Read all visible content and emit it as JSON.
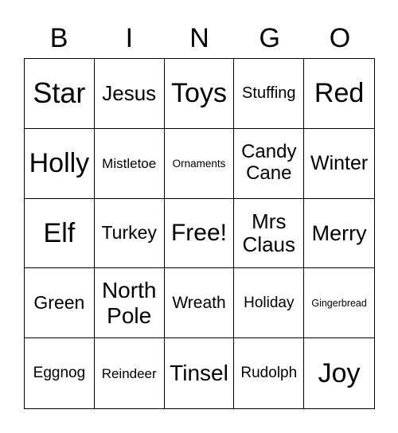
{
  "header": [
    "B",
    "I",
    "N",
    "G",
    "O"
  ],
  "cells": [
    "Star",
    "Jesus",
    "Toys",
    "Stuffing",
    "Red",
    "Holly",
    "Mistletoe",
    "Ornaments",
    "Candy Cane",
    "Winter",
    "Elf",
    "Turkey",
    "Free!",
    "Mrs Claus",
    "Merry",
    "Green",
    "North Pole",
    "Wreath",
    "Holiday",
    "Gingerbread",
    "Eggnog",
    "Reindeer",
    "Tinsel",
    "Rudolph",
    "Joy"
  ]
}
